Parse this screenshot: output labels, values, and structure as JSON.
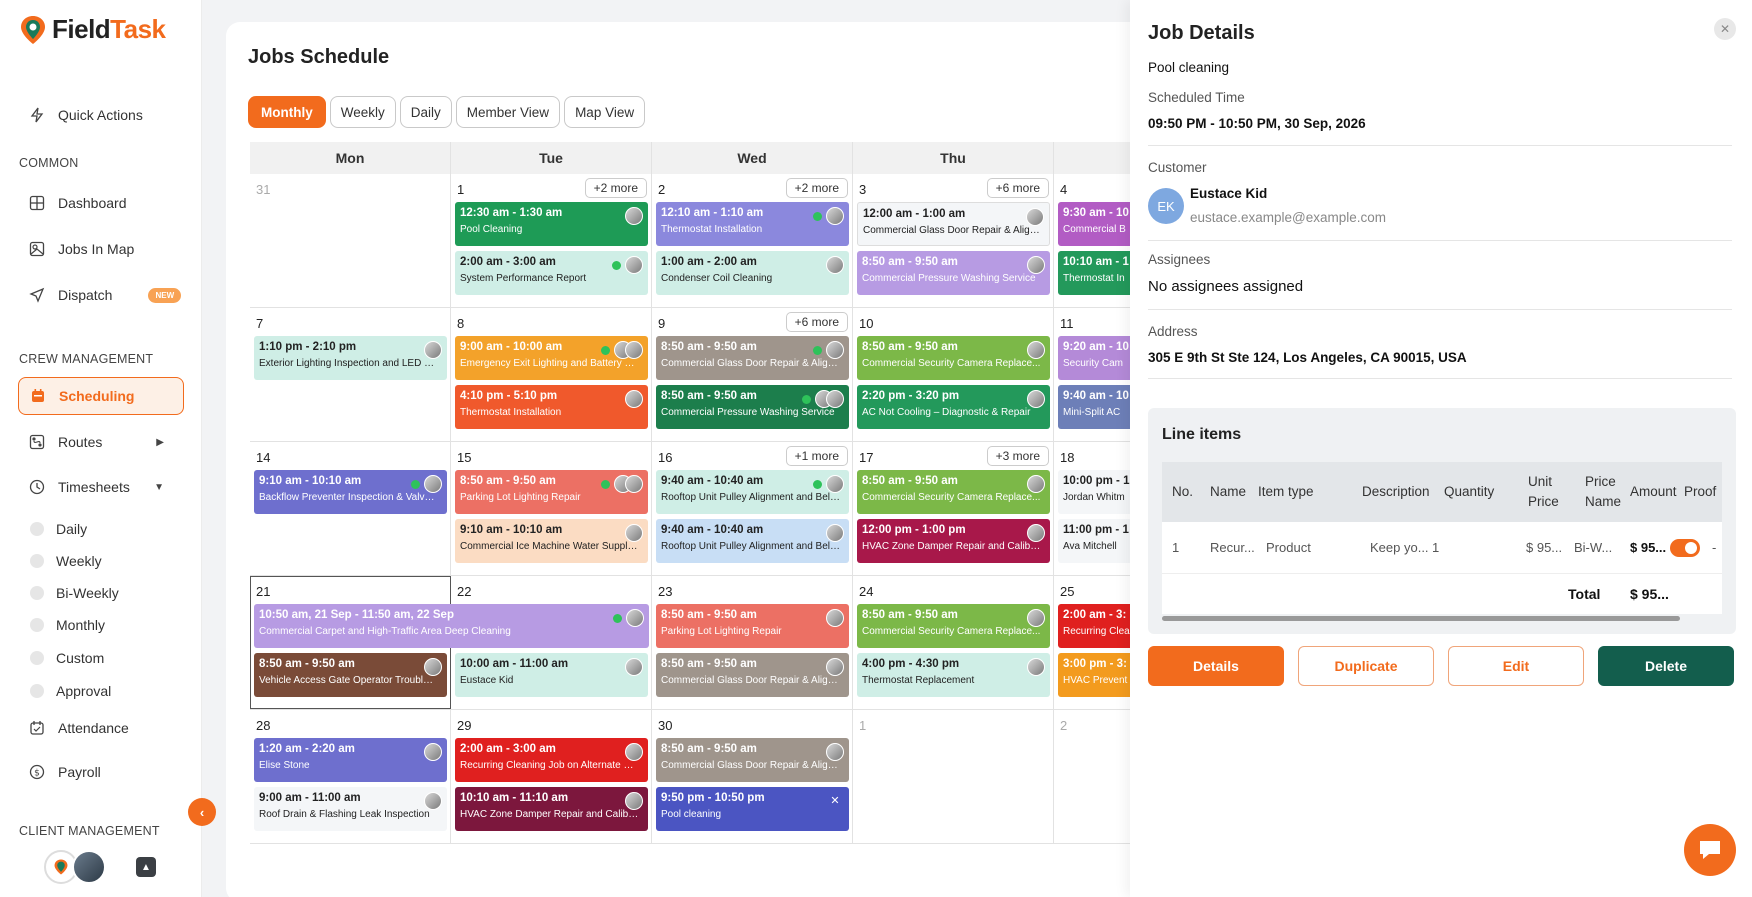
{
  "app": {
    "name_main": "Field",
    "name_accent": "Task"
  },
  "sidebar": {
    "quick_actions": "Quick Actions",
    "common_label": "COMMON",
    "dashboard": "Dashboard",
    "jobs_in_map": "Jobs In Map",
    "dispatch": "Dispatch",
    "new_badge": "NEW",
    "crew_label": "CREW MANAGEMENT",
    "scheduling": "Scheduling",
    "routes": "Routes",
    "timesheets": "Timesheets",
    "timesheet_items": [
      "Daily",
      "Weekly",
      "Bi-Weekly",
      "Monthly",
      "Custom",
      "Approval"
    ],
    "attendance": "Attendance",
    "payroll": "Payroll",
    "client_label": "CLIENT MANAGEMENT"
  },
  "main": {
    "title": "Jobs Schedule",
    "tabs": [
      "Monthly",
      "Weekly",
      "Daily",
      "Member View",
      "Map View"
    ],
    "weekdays": [
      "Mon",
      "Tue",
      "Wed",
      "Thu",
      ""
    ],
    "more": {
      "tue1": "+2 more",
      "wed2": "+2 more",
      "thu3": "+6 more",
      "wed9": "+6 more",
      "wed16": "+1 more",
      "thu17": "+3 more"
    },
    "days": [
      "31",
      "1",
      "2",
      "3",
      "4",
      "7",
      "8",
      "9",
      "10",
      "11",
      "14",
      "15",
      "16",
      "17",
      "18",
      "21",
      "22",
      "23",
      "24",
      "25",
      "28",
      "29",
      "30",
      "1",
      "2"
    ],
    "events": {
      "d1a": {
        "t": "12:30 am - 1:30 am",
        "n": "Pool Cleaning"
      },
      "d1b": {
        "t": "2:00 am - 3:00 am",
        "n": "System Performance Report"
      },
      "d2a": {
        "t": "12:10 am - 1:10 am",
        "n": "Thermostat Installation"
      },
      "d2b": {
        "t": "1:00 am - 2:00 am",
        "n": "Condenser Coil Cleaning"
      },
      "d3a": {
        "t": "12:00 am - 1:00 am",
        "n": "Commercial Glass Door Repair & Align..."
      },
      "d3b": {
        "t": "8:50 am - 9:50 am",
        "n": "Commercial Pressure Washing Service"
      },
      "d4a": {
        "t": "9:30 am - 10",
        "n": "Commercial B"
      },
      "d4b": {
        "t": "10:10 am - 1",
        "n": "Thermostat In"
      },
      "d7a": {
        "t": "1:10 pm - 2:10 pm",
        "n": "Exterior Lighting Inspection and LED Fix..."
      },
      "d8a": {
        "t": "9:00 am - 10:00 am",
        "n": "Emergency Exit Lighting and Battery Ba..."
      },
      "d8b": {
        "t": "4:10 pm - 5:10 pm",
        "n": "Thermostat Installation"
      },
      "d9a": {
        "t": "8:50 am - 9:50 am",
        "n": "Commercial Glass Door Repair & Align..."
      },
      "d9b": {
        "t": "8:50 am - 9:50 am",
        "n": "Commercial Pressure Washing Service"
      },
      "d10a": {
        "t": "8:50 am - 9:50 am",
        "n": "Commercial Security Camera Replace..."
      },
      "d10b": {
        "t": "2:20 pm - 3:20 pm",
        "n": "AC Not Cooling – Diagnostic & Repair"
      },
      "d11a": {
        "t": "9:20 am - 10",
        "n": "Security Cam"
      },
      "d11b": {
        "t": "9:40 am - 10",
        "n": "Mini-Split AC"
      },
      "d14a": {
        "t": "9:10 am - 10:10 am",
        "n": "Backflow Preventer Inspection & Valve R..."
      },
      "d15a": {
        "t": "8:50 am - 9:50 am",
        "n": "Parking Lot Lighting Repair"
      },
      "d15b": {
        "t": "9:10 am - 10:10 am",
        "n": "Commercial Ice Machine Water Supply ..."
      },
      "d16a": {
        "t": "9:40 am - 10:40 am",
        "n": "Rooftop Unit Pulley Alignment and Belt ..."
      },
      "d16b": {
        "t": "9:40 am - 10:40 am",
        "n": "Rooftop Unit Pulley Alignment and Belt ..."
      },
      "d17a": {
        "t": "8:50 am - 9:50 am",
        "n": "Commercial Security Camera Replace..."
      },
      "d17b": {
        "t": "12:00 pm - 1:00 pm",
        "n": "HVAC Zone Damper Repair and Calibra..."
      },
      "d18a": {
        "t": "10:00 pm - 1",
        "n": "Jordan Whitm"
      },
      "d18b": {
        "t": "11:00 pm - 1",
        "n": "Ava Mitchell"
      },
      "d21a": {
        "t": "10:50 am, 21 Sep - 11:50 am, 22 Sep",
        "n": "Commercial Carpet and High-Traffic Area Deep Cleaning"
      },
      "d21b": {
        "t": "8:50 am - 9:50 am",
        "n": "Vehicle Access Gate Operator Troublesh..."
      },
      "d22b": {
        "t": "10:00 am - 11:00 am",
        "n": "Eustace Kid"
      },
      "d23a": {
        "t": "8:50 am - 9:50 am",
        "n": "Parking Lot Lighting Repair"
      },
      "d23b": {
        "t": "8:50 am - 9:50 am",
        "n": "Commercial Glass Door Repair & Align..."
      },
      "d24a": {
        "t": "8:50 am - 9:50 am",
        "n": "Commercial Security Camera Replace..."
      },
      "d24b": {
        "t": "4:00 pm - 4:30 pm",
        "n": "Thermostat Replacement"
      },
      "d25a": {
        "t": "2:00 am - 3:",
        "n": "Recurring Clea"
      },
      "d25b": {
        "t": "3:00 pm - 3:",
        "n": "HVAC Prevent"
      },
      "d28a": {
        "t": "1:20 am - 2:20 am",
        "n": "Elise Stone"
      },
      "d28b": {
        "t": "9:00 am - 11:00 am",
        "n": "Roof Drain & Flashing Leak Inspection"
      },
      "d29a": {
        "t": "2:00 am - 3:00 am",
        "n": "Recurring Cleaning Job on Alternate Fri..."
      },
      "d29b": {
        "t": "10:10 am - 11:10 am",
        "n": "HVAC Zone Damper Repair and Calibra..."
      },
      "d30a": {
        "t": "8:50 am - 9:50 am",
        "n": "Commercial Glass Door Repair & Align..."
      },
      "d30b": {
        "t": "9:50 pm - 10:50 pm",
        "n": "Pool cleaning"
      }
    }
  },
  "panel": {
    "title": "Job Details",
    "job_name": "Pool cleaning",
    "scheduled_label": "Scheduled Time",
    "scheduled_value": "09:50 PM - 10:50 PM, 30 Sep, 2026",
    "customer_label": "Customer",
    "customer_initials": "EK",
    "customer_name": "Eustace Kid",
    "customer_email": "eustace.example@example.com",
    "assignees_label": "Assignees",
    "assignees_value": "No assignees assigned",
    "address_label": "Address",
    "address_value": "305 E 9th St Ste 124, Los Angeles, CA 90015, USA",
    "line_items": {
      "title": "Line items",
      "headers": {
        "no": "No.",
        "name": "Name",
        "item_type": "Item type",
        "description": "Description",
        "quantity": "Quantity",
        "unit_price_1": "Unit",
        "unit_price_2": "Price",
        "price_name_1": "Price",
        "price_name_2": "Name",
        "amount": "Amount",
        "proof": "Proof"
      },
      "row": {
        "no": "1",
        "name": "Recur...",
        "item_type": "Product",
        "description": "Keep yo...",
        "quantity": "1",
        "unit_price": "$ 95...",
        "price_name": "Bi-W...",
        "amount": "$ 95...",
        "proof_tail": "-"
      },
      "total_label": "Total",
      "total_value": "$ 95..."
    },
    "buttons": {
      "details": "Details",
      "duplicate": "Duplicate",
      "edit": "Edit",
      "delete": "Delete"
    }
  }
}
